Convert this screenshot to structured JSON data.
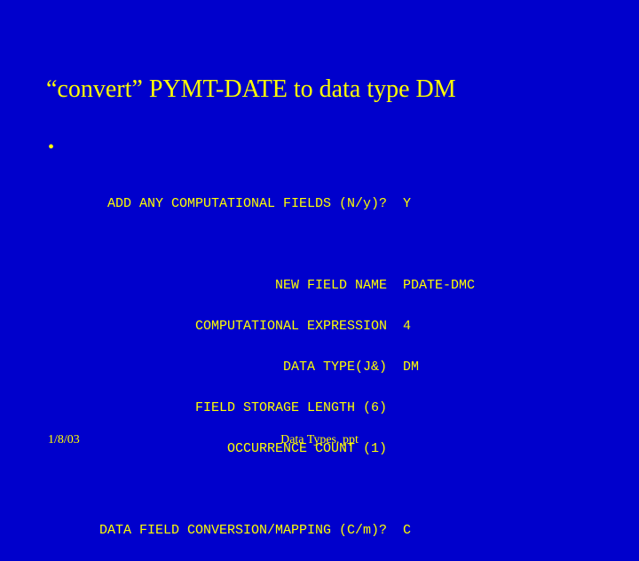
{
  "title": "“convert” PYMT-DATE to data type DM",
  "bullet": "•",
  "lines": {
    "l1": {
      "label": "ADD ANY COMPUTATIONAL FIELDS (N/y)?",
      "val": "Y"
    },
    "l2": {
      "label": "NEW FIELD NAME",
      "val": "PDATE-DMC"
    },
    "l3": {
      "label": "COMPUTATIONAL EXPRESSION",
      "val": "4"
    },
    "l4": {
      "label": "DATA TYPE(J&)",
      "val": "DM"
    },
    "l5": {
      "label": "FIELD STORAGE LENGTH (6)",
      "val": ""
    },
    "l6": {
      "label": "OCCURRENCE COUNT (1)",
      "val": ""
    },
    "l7": {
      "label": "DATA FIELD CONVERSION/MAPPING (C/m)?",
      "val": "C"
    }
  },
  "footer": {
    "date": "1/8/03",
    "file": "Data Types. ppt"
  }
}
